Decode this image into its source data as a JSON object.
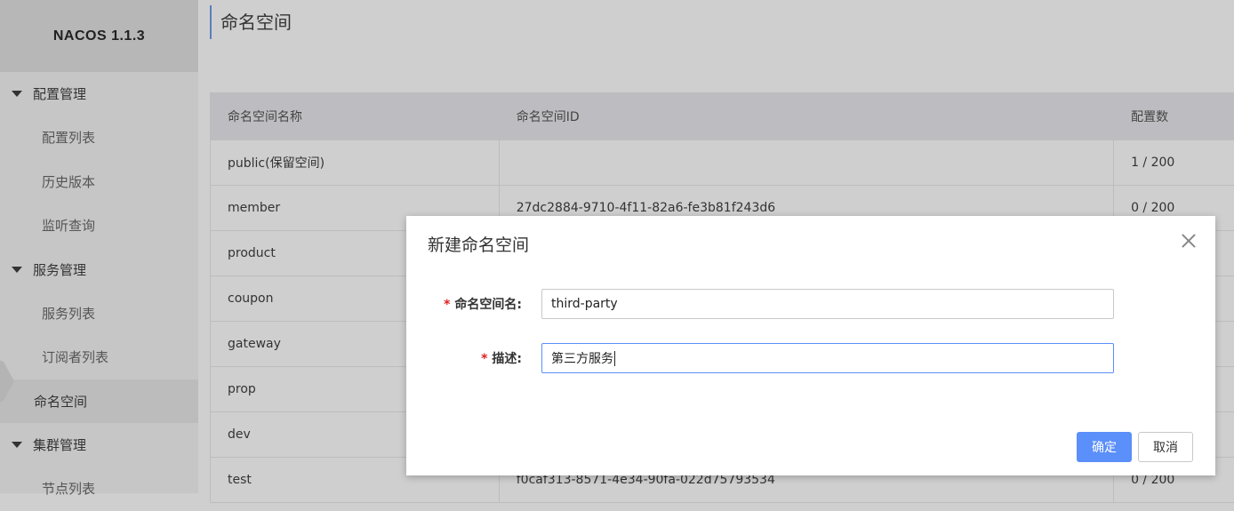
{
  "app": {
    "brand": "NACOS 1.1.3"
  },
  "sidebar": {
    "groups": [
      {
        "label": "配置管理",
        "items": [
          "配置列表",
          "历史版本",
          "监听查询"
        ]
      },
      {
        "label": "服务管理",
        "items": [
          "服务列表",
          "订阅者列表"
        ]
      },
      {
        "label": "集群管理",
        "items": [
          "节点列表"
        ]
      }
    ],
    "active_item": "命名空间"
  },
  "page": {
    "title": "命名空间"
  },
  "table": {
    "columns": [
      "命名空间名称",
      "命名空间ID",
      "配置数"
    ],
    "rows": [
      [
        "public(保留空间)",
        "",
        "1 / 200"
      ],
      [
        "member",
        "27dc2884-9710-4f11-82a6-fe3b81f243d6",
        "0 / 200"
      ],
      [
        "product",
        "",
        ""
      ],
      [
        "coupon",
        "",
        ""
      ],
      [
        "gateway",
        "",
        ""
      ],
      [
        "prop",
        "",
        ""
      ],
      [
        "dev",
        "",
        ""
      ],
      [
        "test",
        "f0caf313-8571-4e34-90fa-022d75793534",
        "0 / 200"
      ]
    ]
  },
  "dialog": {
    "title": "新建命名空间",
    "fields": {
      "name": {
        "label": "命名空间名:",
        "value": "third-party"
      },
      "desc": {
        "label": "描述:",
        "value": "第三方服务"
      }
    },
    "required_mark": "*",
    "ok_label": "确定",
    "cancel_label": "取消"
  },
  "colors": {
    "primary": "#5b8ff9",
    "required": "#e02020"
  }
}
